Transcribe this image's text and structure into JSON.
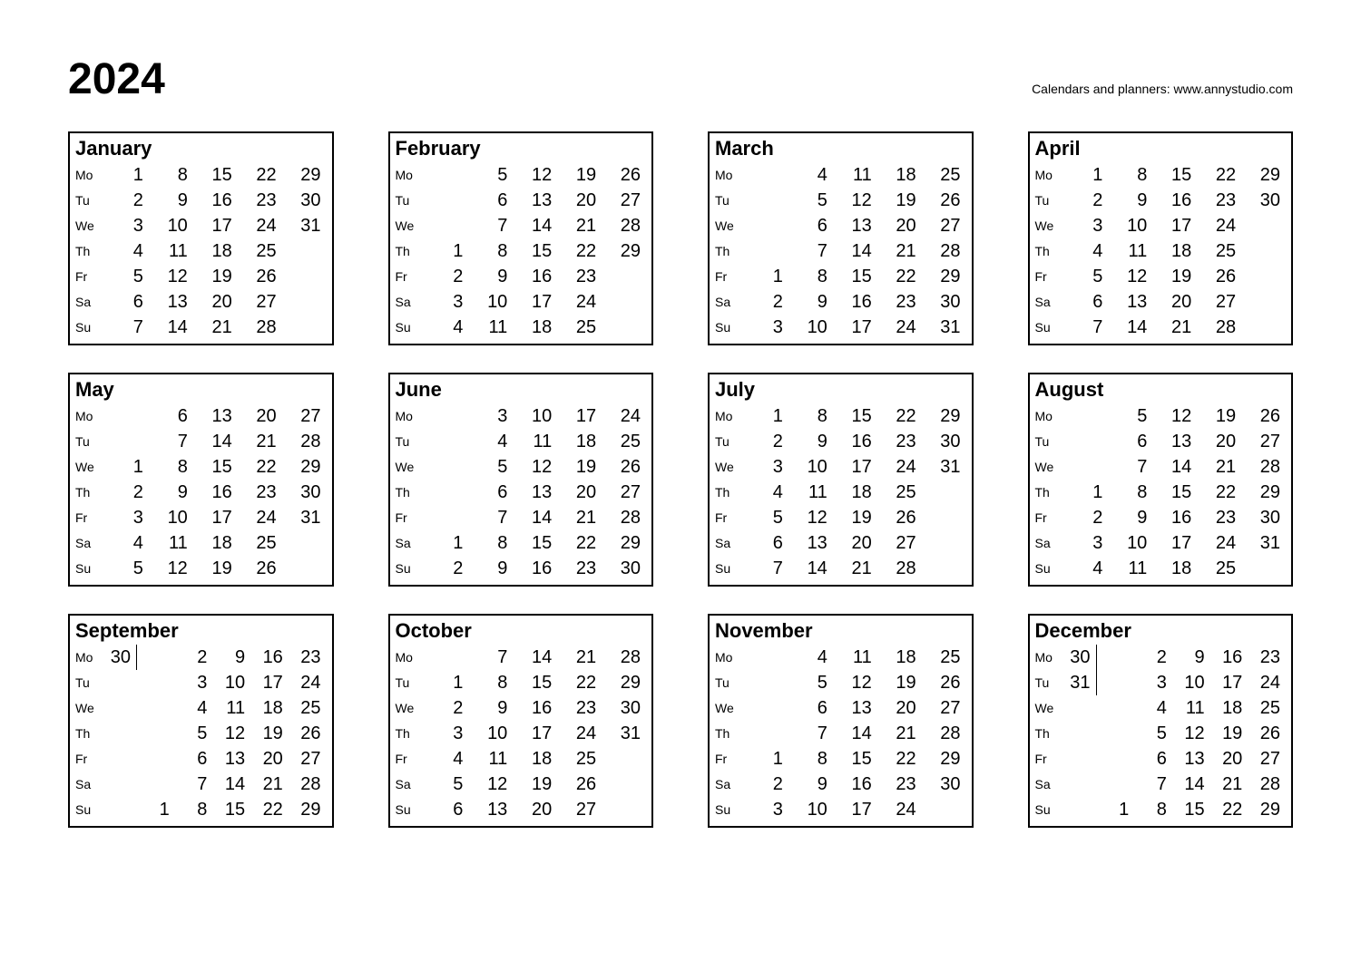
{
  "year": "2024",
  "attribution": "Calendars and planners:  www.annystudio.com",
  "day_labels": [
    "Mo",
    "Tu",
    "We",
    "Th",
    "Fr",
    "Sa",
    "Su"
  ],
  "months": [
    {
      "name": "January",
      "weeks": [
        [
          1,
          2,
          3,
          4,
          5,
          6,
          7
        ],
        [
          8,
          9,
          10,
          11,
          12,
          13,
          14
        ],
        [
          15,
          16,
          17,
          18,
          19,
          20,
          21
        ],
        [
          22,
          23,
          24,
          25,
          26,
          27,
          28
        ],
        [
          29,
          30,
          31,
          "",
          "",
          "",
          ""
        ]
      ],
      "sixth": null
    },
    {
      "name": "February",
      "weeks": [
        [
          "",
          "",
          "",
          1,
          2,
          3,
          4
        ],
        [
          5,
          6,
          7,
          8,
          9,
          10,
          11
        ],
        [
          12,
          13,
          14,
          15,
          16,
          17,
          18
        ],
        [
          19,
          20,
          21,
          22,
          23,
          24,
          25
        ],
        [
          26,
          27,
          28,
          29,
          "",
          "",
          ""
        ]
      ],
      "sixth": null
    },
    {
      "name": "March",
      "weeks": [
        [
          "",
          "",
          "",
          "",
          1,
          2,
          3
        ],
        [
          4,
          5,
          6,
          7,
          8,
          9,
          10
        ],
        [
          11,
          12,
          13,
          14,
          15,
          16,
          17
        ],
        [
          18,
          19,
          20,
          21,
          22,
          23,
          24
        ],
        [
          25,
          26,
          27,
          28,
          29,
          30,
          31
        ]
      ],
      "sixth": null
    },
    {
      "name": "April",
      "weeks": [
        [
          1,
          2,
          3,
          4,
          5,
          6,
          7
        ],
        [
          8,
          9,
          10,
          11,
          12,
          13,
          14
        ],
        [
          15,
          16,
          17,
          18,
          19,
          20,
          21
        ],
        [
          22,
          23,
          24,
          25,
          26,
          27,
          28
        ],
        [
          29,
          30,
          "",
          "",
          "",
          "",
          ""
        ]
      ],
      "sixth": null
    },
    {
      "name": "May",
      "weeks": [
        [
          "",
          "",
          1,
          2,
          3,
          4,
          5
        ],
        [
          6,
          7,
          8,
          9,
          10,
          11,
          12
        ],
        [
          13,
          14,
          15,
          16,
          17,
          18,
          19
        ],
        [
          20,
          21,
          22,
          23,
          24,
          25,
          26
        ],
        [
          27,
          28,
          29,
          30,
          31,
          "",
          ""
        ]
      ],
      "sixth": null
    },
    {
      "name": "June",
      "weeks": [
        [
          "",
          "",
          "",
          "",
          "",
          1,
          2
        ],
        [
          3,
          4,
          5,
          6,
          7,
          8,
          9
        ],
        [
          10,
          11,
          12,
          13,
          14,
          15,
          16
        ],
        [
          17,
          18,
          19,
          20,
          21,
          22,
          23
        ],
        [
          24,
          25,
          26,
          27,
          28,
          29,
          30
        ]
      ],
      "sixth": null
    },
    {
      "name": "July",
      "weeks": [
        [
          1,
          2,
          3,
          4,
          5,
          6,
          7
        ],
        [
          8,
          9,
          10,
          11,
          12,
          13,
          14
        ],
        [
          15,
          16,
          17,
          18,
          19,
          20,
          21
        ],
        [
          22,
          23,
          24,
          25,
          26,
          27,
          28
        ],
        [
          29,
          30,
          31,
          "",
          "",
          "",
          ""
        ]
      ],
      "sixth": null
    },
    {
      "name": "August",
      "weeks": [
        [
          "",
          "",
          "",
          1,
          2,
          3,
          4
        ],
        [
          5,
          6,
          7,
          8,
          9,
          10,
          11
        ],
        [
          12,
          13,
          14,
          15,
          16,
          17,
          18
        ],
        [
          19,
          20,
          21,
          22,
          23,
          24,
          25
        ],
        [
          26,
          27,
          28,
          29,
          30,
          31,
          ""
        ]
      ],
      "sixth": null
    },
    {
      "name": "September",
      "weeks": [
        [
          "",
          "",
          "",
          "",
          "",
          "",
          1
        ],
        [
          2,
          3,
          4,
          5,
          6,
          7,
          8
        ],
        [
          9,
          10,
          11,
          12,
          13,
          14,
          15
        ],
        [
          16,
          17,
          18,
          19,
          20,
          21,
          22
        ],
        [
          23,
          24,
          25,
          26,
          27,
          28,
          29
        ]
      ],
      "sixth": [
        30,
        "",
        "",
        "",
        "",
        "",
        ""
      ]
    },
    {
      "name": "October",
      "weeks": [
        [
          "",
          1,
          2,
          3,
          4,
          5,
          6
        ],
        [
          7,
          8,
          9,
          10,
          11,
          12,
          13
        ],
        [
          14,
          15,
          16,
          17,
          18,
          19,
          20
        ],
        [
          21,
          22,
          23,
          24,
          25,
          26,
          27
        ],
        [
          28,
          29,
          30,
          31,
          "",
          "",
          ""
        ]
      ],
      "sixth": null
    },
    {
      "name": "November",
      "weeks": [
        [
          "",
          "",
          "",
          "",
          1,
          2,
          3
        ],
        [
          4,
          5,
          6,
          7,
          8,
          9,
          10
        ],
        [
          11,
          12,
          13,
          14,
          15,
          16,
          17
        ],
        [
          18,
          19,
          20,
          21,
          22,
          23,
          24
        ],
        [
          25,
          26,
          27,
          28,
          29,
          30,
          ""
        ]
      ],
      "sixth": null
    },
    {
      "name": "December",
      "weeks": [
        [
          "",
          "",
          "",
          "",
          "",
          "",
          1
        ],
        [
          2,
          3,
          4,
          5,
          6,
          7,
          8
        ],
        [
          9,
          10,
          11,
          12,
          13,
          14,
          15
        ],
        [
          16,
          17,
          18,
          19,
          20,
          21,
          22
        ],
        [
          23,
          24,
          25,
          26,
          27,
          28,
          29
        ]
      ],
      "sixth": [
        30,
        31,
        "",
        "",
        "",
        "",
        ""
      ]
    }
  ]
}
